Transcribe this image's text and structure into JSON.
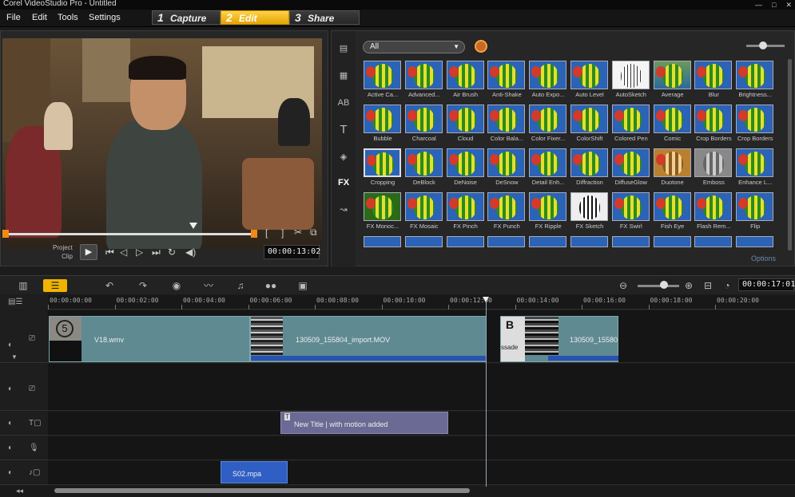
{
  "window": {
    "title": "Corel VideoStudio Pro - Untitled"
  },
  "menu": {
    "items": [
      "File",
      "Edit",
      "Tools",
      "Settings"
    ]
  },
  "steps": [
    {
      "num": "1",
      "label": "Capture"
    },
    {
      "num": "2",
      "label": "Edit"
    },
    {
      "num": "3",
      "label": "Share"
    }
  ],
  "preview": {
    "project_label": "Project",
    "clip_label": "Clip",
    "timecode": "00:00:13:02"
  },
  "library": {
    "filter": "All",
    "side_tab_fx": "FX",
    "options_label": "Options",
    "effects": [
      "Active Ca...",
      "Advanced...",
      "Air Brush",
      "Anti-Shake",
      "Auto Expo...",
      "Auto Level",
      "AutoSketch",
      "Average",
      "Blur",
      "Brightness...",
      "Bubble",
      "Charcoal",
      "Cloud",
      "Color Bala...",
      "Color Fixer...",
      "ColorShift",
      "Colored Pen",
      "Comic",
      "Crop Borders",
      "Crop Borders",
      "Cropping",
      "DeBlock",
      "DeNoise",
      "DeSnow",
      "Detail Enh...",
      "Diffraction",
      "DiffuseGlow",
      "Duotone",
      "Emboss",
      "Enhance L...",
      "FX Monoc...",
      "FX Mosaic",
      "FX Pinch",
      "FX Punch",
      "FX Ripple",
      "FX Sketch",
      "FX Swirl",
      "Fish Eye",
      "Flash Rem...",
      "Flip"
    ]
  },
  "timeline": {
    "timecode": "00:00:17:01",
    "ruler": [
      "00:00:00:00",
      "00:00:02:00",
      "00:00:04:00",
      "00:00:06:00",
      "00:00:08:00",
      "00:00:10:00",
      "00:00:12:00",
      "00:00:14:00",
      "00:00:16:00",
      "00:00:18:00",
      "00:00:20:00"
    ],
    "video_clips": [
      {
        "name": "V18.wmv",
        "thumb_text": "5"
      },
      {
        "name": "130509_155804_import.MOV"
      },
      {
        "name": "130509_15580",
        "thumb_text": "B"
      }
    ],
    "overlay_text": "ssade",
    "title_clip": "New Title | with motion added",
    "audio_clip": "S02.mpa"
  },
  "colors": {
    "accent": "#f0b400",
    "clip_video": "#5f8a92",
    "clip_title": "#6a6a94",
    "clip_audio": "#2f5fc4"
  }
}
